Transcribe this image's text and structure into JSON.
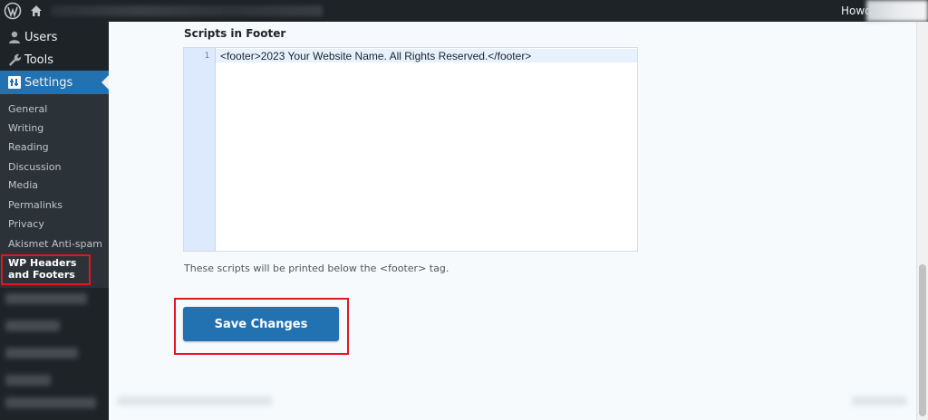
{
  "admin_bar": {
    "greeting": "Howdy",
    "icons": [
      "wordpress-logo-icon",
      "home-icon"
    ]
  },
  "sidebar": {
    "menu": [
      {
        "label": "Users",
        "icon": "users-icon"
      },
      {
        "label": "Tools",
        "icon": "wrench-icon"
      },
      {
        "label": "Settings",
        "icon": "settings-icon",
        "active": true
      }
    ],
    "submenu": [
      "General",
      "Writing",
      "Reading",
      "Discussion",
      "Media",
      "Permalinks",
      "Privacy",
      "Akismet Anti-spam",
      "WP Headers and Footers"
    ],
    "current_submenu": "WP Headers and Footers"
  },
  "footer_scripts": {
    "label": "Scripts in Footer",
    "line_number": "1",
    "code": "<footer>2023 Your Website Name. All Rights Reserved.</footer>",
    "help_text": "These scripts will be printed below the <footer> tag."
  },
  "actions": {
    "save_label": "Save Changes"
  },
  "colors": {
    "accent": "#2271b1",
    "sidebar_bg": "#1d2327",
    "highlight_border": "#e5151f"
  }
}
